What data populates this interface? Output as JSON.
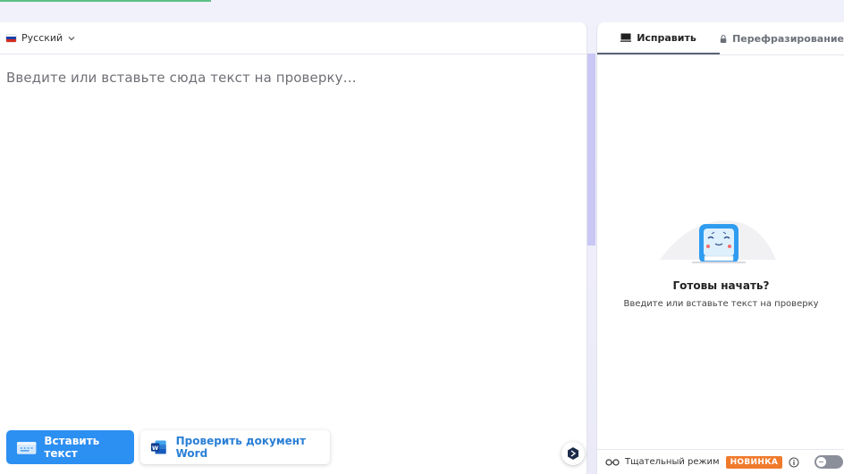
{
  "editor": {
    "language": "Русский",
    "placeholder": "Введите или вставьте сюда текст на проверку…",
    "insert_button": "Вставить текст",
    "word_button": "Проверить документ Word"
  },
  "right_panel": {
    "tabs": [
      {
        "label": "Исправить",
        "icon": "monitor-icon",
        "active": true
      },
      {
        "label": "Перефразирование",
        "icon": "lock-icon",
        "active": false
      }
    ],
    "empty_title": "Готовы начать?",
    "empty_subtitle": "Введите или вставьте текст на проверку",
    "thorough_mode_label": "Тщательный режим",
    "new_badge": "НОВИНКА",
    "thorough_mode_enabled": false
  },
  "colors": {
    "primary_button": "#2c8ff2",
    "word_button_text": "#2a7fd6",
    "badge": "#f07a2c",
    "toggle_off": "#8a8f9a",
    "top_accent": "#5dbf86"
  }
}
